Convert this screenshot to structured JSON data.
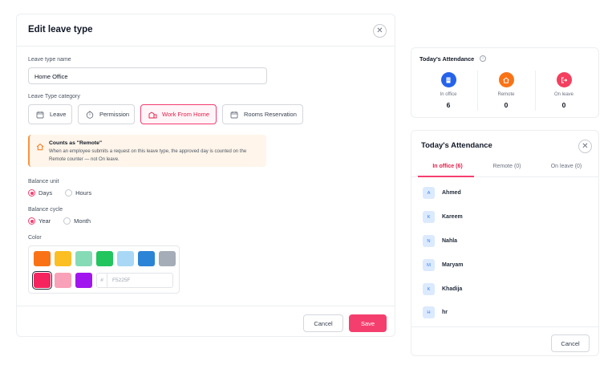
{
  "edit_modal": {
    "title": "Edit leave type",
    "name_label": "Leave type name",
    "name_value": "Home Office",
    "category_label": "Leave Type category",
    "categories": [
      {
        "label": "Leave",
        "icon": "calendar-icon",
        "active": false
      },
      {
        "label": "Permission",
        "icon": "clock-icon",
        "active": false
      },
      {
        "label": "Work From Home",
        "icon": "home-work-icon",
        "active": true
      },
      {
        "label": "Rooms Reservation",
        "icon": "calendar-room-icon",
        "active": false
      }
    ],
    "note": {
      "title": "Counts as \"Remote\"",
      "body": "When an employee submits a request on this leave type, the approved day is counted on the Remote counter — not On leave."
    },
    "balance_unit_label": "Balance unit",
    "balance_unit_options": [
      "Days",
      "Hours"
    ],
    "balance_unit_selected": "Days",
    "balance_cycle_label": "Balance cycle",
    "balance_cycle_options": [
      "Year",
      "Month"
    ],
    "balance_cycle_selected": "Year",
    "color_label": "Color",
    "swatches": [
      "#f97316",
      "#fbbf24",
      "#86dbb7",
      "#22c55e",
      "#a8d8f5",
      "#2b84d6",
      "#a5adb8",
      "#f5245f",
      "#f9a1b8",
      "#a116ee"
    ],
    "selected_swatch": "#f5245f",
    "hex_prefix": "#",
    "hex_value": "F5225F",
    "cancel_label": "Cancel",
    "save_label": "Save"
  },
  "summary": {
    "title": "Today's Attendance",
    "stats": [
      {
        "label": "In office",
        "value": "6",
        "color": "#2563eb",
        "icon": "building-icon"
      },
      {
        "label": "Remote",
        "value": "0",
        "color": "#f97316",
        "icon": "home-icon"
      },
      {
        "label": "On leave",
        "value": "0",
        "color": "#f43f5e",
        "icon": "logout-icon"
      }
    ]
  },
  "list_modal": {
    "title": "Today's Attendance",
    "tabs": [
      "In office (6)",
      "Remote (0)",
      "On leave (0)"
    ],
    "active_tab": 0,
    "people": [
      {
        "initial": "A",
        "name": "Ahmed"
      },
      {
        "initial": "K",
        "name": "Kareem"
      },
      {
        "initial": "N",
        "name": "Nahla"
      },
      {
        "initial": "M",
        "name": "Maryam"
      },
      {
        "initial": "K",
        "name": "Khadija"
      },
      {
        "initial": "H",
        "name": "hr"
      }
    ],
    "cancel_label": "Cancel"
  },
  "colors": {
    "accent": "#f43f6e",
    "note_bg": "#fff5ea",
    "avatar_bg": "#dbeafe"
  }
}
